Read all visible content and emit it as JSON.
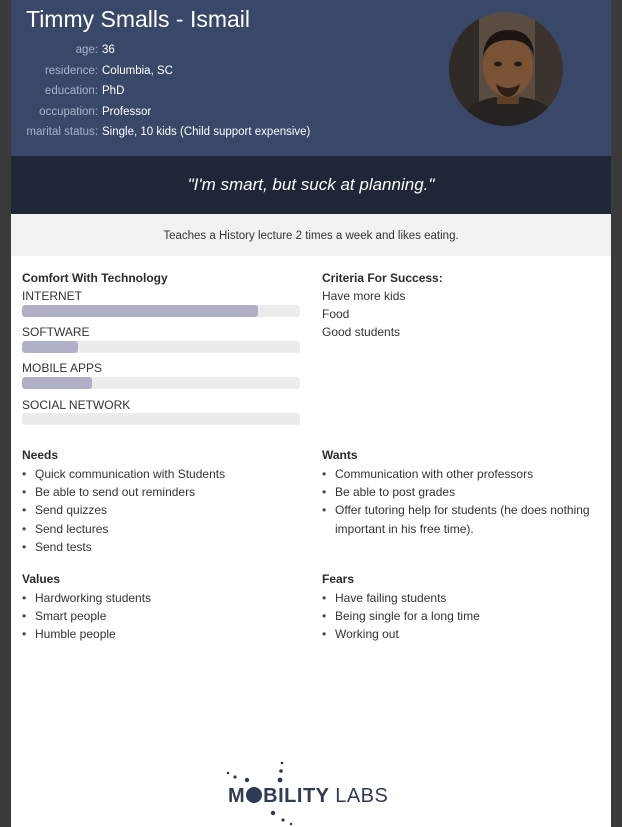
{
  "persona": {
    "name": "Timmy Smalls - Ismail",
    "info": [
      {
        "label": "age:",
        "value": "36"
      },
      {
        "label": "residence:",
        "value": "Columbia, SC"
      },
      {
        "label": "education:",
        "value": "PhD"
      },
      {
        "label": "occupation:",
        "value": "Professor"
      },
      {
        "label": "marital status:",
        "value": "Single, 10 kids (Child support expensive)"
      }
    ],
    "quote": "\"I'm smart, but suck at planning.\"",
    "bio": "Teaches a History lecture 2 times a week and likes eating."
  },
  "technology": {
    "title": "Comfort With Technology",
    "items": [
      {
        "label": "INTERNET",
        "level": 0.85
      },
      {
        "label": "SOFTWARE",
        "level": 0.2
      },
      {
        "label": "MOBILE APPS",
        "level": 0.25
      },
      {
        "label": "SOCIAL NETWORK",
        "level": 0.0
      }
    ]
  },
  "criteria": {
    "title": "Criteria For Success:",
    "items": [
      "Have more kids",
      "Food",
      "Good students"
    ]
  },
  "needs": {
    "title": "Needs",
    "items": [
      "Quick communication with Students",
      "Be able to send out reminders",
      "Send quizzes",
      "Send lectures",
      "Send tests"
    ]
  },
  "wants": {
    "title": "Wants",
    "items": [
      "Communication with other professors",
      "Be able to post grades",
      "Offer tutoring help for students (he does nothing important in his free time)."
    ]
  },
  "values": {
    "title": "Values",
    "items": [
      "Hardworking students",
      "Smart people",
      "Humble people"
    ]
  },
  "fears": {
    "title": "Fears",
    "items": [
      "Have failing students",
      "Being single for a long time",
      "Working out"
    ]
  },
  "logo": {
    "part1": "M",
    "part2": "BILITY",
    "part3": "LABS"
  },
  "colors": {
    "header": "#394869",
    "quote_band": "#1e2638",
    "bar_fill": "#b0b0c8",
    "bar_track": "#ececec",
    "logo": "#2f3a56"
  },
  "icons": {
    "avatar": "person-photo"
  }
}
